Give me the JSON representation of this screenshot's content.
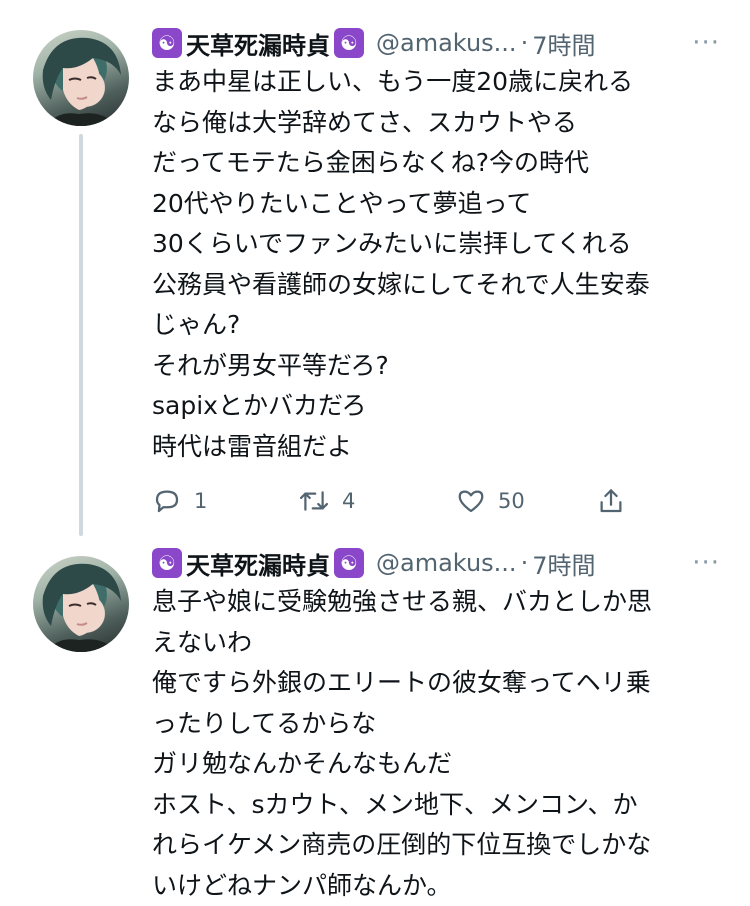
{
  "tweets": [
    {
      "author": {
        "badge_icon": "yin-yang",
        "badge_glyph": "☯",
        "name": "天草死漏時貞",
        "handle": "@amakus...",
        "separator": "·",
        "time": "7時間",
        "more": "···"
      },
      "lines": [
        "まあ中星は正しい、もう一度20歳に戻れる",
        "なら俺は大学辞めてさ、スカウトやる",
        "だってモテたら金困らなくね?今の時代",
        "20代やりたいことやって夢追って",
        "30くらいでファンみたいに崇拝してくれる",
        "公務員や看護師の女嫁にしてそれで人生安泰",
        "じゃん?",
        "それが男女平等だろ?",
        "sapixとかバカだろ",
        "時代は雷音組だよ"
      ],
      "actions": {
        "reply_count": "1",
        "retweet_count": "4",
        "like_count": "50"
      }
    },
    {
      "author": {
        "badge_icon": "yin-yang",
        "badge_glyph": "☯",
        "name": "天草死漏時貞",
        "handle": "@amakus...",
        "separator": "·",
        "time": "7時間",
        "more": "···"
      },
      "lines": [
        "息子や娘に受験勉強させる親、バカとしか思",
        "えないわ",
        "俺ですら外銀のエリートの彼女奪ってヘリ乗",
        "ったりしてるからな",
        "ガリ勉なんかそんなもんだ",
        "ホスト、sカウト、メン地下、メンコン、か",
        "れらイケメン商売の圧倒的下位互換でしかな",
        "いけどねナンパ師なんか。"
      ]
    }
  ],
  "colors": {
    "badge": "#8a47c9",
    "text": "#0f1419",
    "muted": "#536471",
    "thread_line": "#cfd9de"
  }
}
